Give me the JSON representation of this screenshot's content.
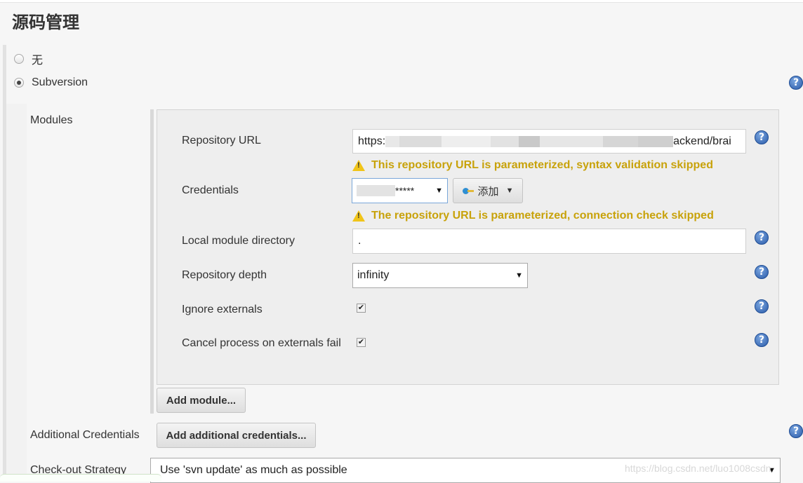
{
  "section": {
    "title": "源码管理"
  },
  "scm_options": [
    {
      "label": "无",
      "checked": false
    },
    {
      "label": "Subversion",
      "checked": true
    }
  ],
  "modules": {
    "label": "Modules",
    "repository_url": {
      "label": "Repository URL",
      "prefix": "https:",
      "suffix": "ackend/brai"
    },
    "url_warning": "This repository URL is parameterized, syntax validation skipped",
    "credentials": {
      "label": "Credentials",
      "value_prefix": "",
      "value_suffix": "*****",
      "add_label": "添加"
    },
    "connection_warning": "The repository URL is parameterized, connection check skipped",
    "local_module_directory": {
      "label": "Local module directory",
      "value": "."
    },
    "repository_depth": {
      "label": "Repository depth",
      "value": "infinity"
    },
    "ignore_externals": {
      "label": "Ignore externals",
      "checked": true
    },
    "cancel_on_externals_fail": {
      "label": "Cancel process on externals fail",
      "checked": true
    },
    "add_module_label": "Add module..."
  },
  "additional_credentials": {
    "label": "Additional Credentials",
    "button_label": "Add additional credentials..."
  },
  "checkout_strategy": {
    "label": "Check-out Strategy",
    "value": "Use 'svn update' as much as possible"
  },
  "watermark": "https://blog.csdn.net/luo1008csdn",
  "colors": {
    "warning": "#c8a20a",
    "help": "#2a5aa8",
    "panel": "#eeeeee"
  }
}
